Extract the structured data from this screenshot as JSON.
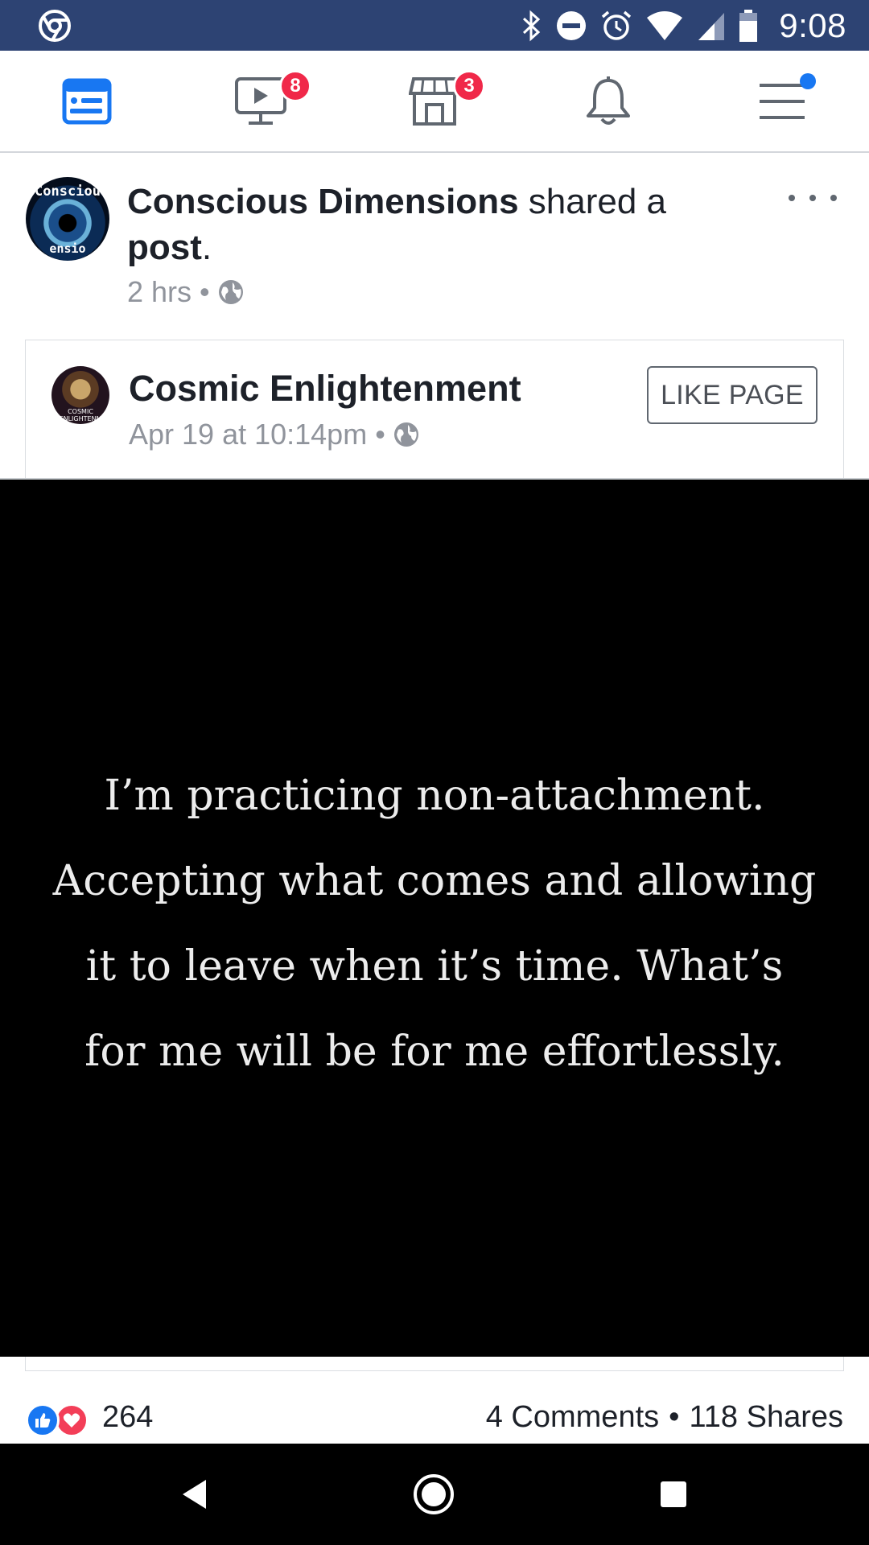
{
  "status_bar": {
    "time": "9:08",
    "icons": [
      "chrome-icon",
      "bluetooth-icon",
      "do-not-disturb-icon",
      "alarm-icon",
      "wifi-icon",
      "signal-icon",
      "battery-icon"
    ],
    "background": "#2d4373"
  },
  "nav": {
    "items": [
      {
        "name": "news-feed",
        "icon": "news-feed-icon",
        "badge": ""
      },
      {
        "name": "watch",
        "icon": "video-icon",
        "badge": "8"
      },
      {
        "name": "marketplace",
        "icon": "marketplace-icon",
        "badge": "3"
      },
      {
        "name": "notifications",
        "icon": "bell-icon",
        "badge": ""
      },
      {
        "name": "menu",
        "icon": "hamburger-menu-icon",
        "badge": ""
      }
    ],
    "active_color": "#1877f2",
    "badge_color": "#f02849"
  },
  "post": {
    "author": "Conscious Dimensions",
    "action_text": " shared a ",
    "object": "post",
    "punctuation": ".",
    "time": "2 hrs",
    "separator": "•",
    "avatar_text_top": "Consciou",
    "avatar_text_bottom": "ensio"
  },
  "shared": {
    "page_name": "Cosmic Enlightenment",
    "date": "Apr 19 at 10:14pm",
    "separator": "•",
    "like_button": "LIKE PAGE",
    "avatar_text": "COSMIC ENLIGHTENM"
  },
  "image": {
    "lines": [
      "I’m practicing non-attachment.",
      "Accepting what comes and allowing",
      "it to leave when it’s time. What’s",
      "for me will be for me effortlessly."
    ]
  },
  "reactions": {
    "count": "264",
    "comments": "4 Comments",
    "separator": "•",
    "shares": "118 Shares",
    "like_color": "#1877f2",
    "love_color": "#f33e58"
  },
  "android_nav": {
    "buttons": [
      "back-button",
      "home-button",
      "recents-button"
    ]
  }
}
